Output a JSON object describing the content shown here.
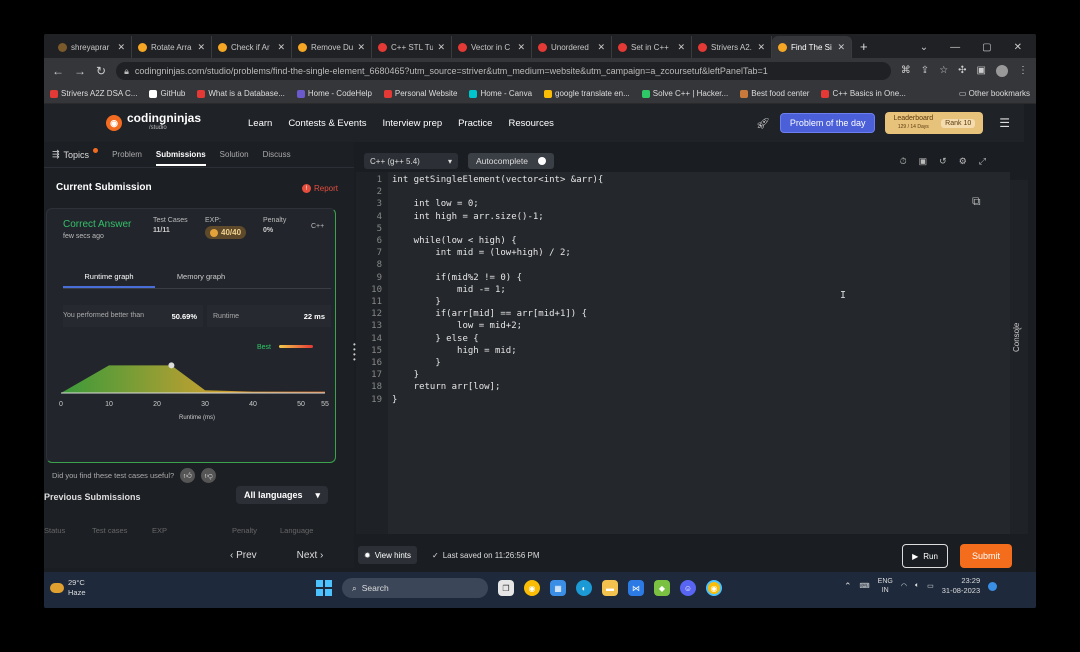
{
  "tabs": [
    {
      "label": "shreyaprar",
      "color": "#7a5a2a"
    },
    {
      "label": "Rotate Arra",
      "color": "#f5a623"
    },
    {
      "label": "Check if Ar",
      "color": "#f5a623"
    },
    {
      "label": "Remove Du",
      "color": "#f5a623"
    },
    {
      "label": "C++ STL Tu",
      "color": "#e53935"
    },
    {
      "label": "Vector in C",
      "color": "#e53935"
    },
    {
      "label": "Unordered",
      "color": "#e53935"
    },
    {
      "label": "Set in C++",
      "color": "#e53935"
    },
    {
      "label": "Strivers A2.",
      "color": "#e53935"
    },
    {
      "label": "Find The Si",
      "color": "#f5a623"
    }
  ],
  "url": "codingninjas.com/studio/problems/find-the-single-element_6680465?utm_source=striver&utm_medium=website&utm_campaign=a_zcoursetuf&leftPanelTab=1",
  "bookmarks": [
    {
      "label": "Strivers A2Z DSA C...",
      "color": "#e53935"
    },
    {
      "label": "GitHub",
      "color": "#ffffff"
    },
    {
      "label": "What is a Database...",
      "color": "#e53935"
    },
    {
      "label": "Home - CodeHelp",
      "color": "#6a5acd"
    },
    {
      "label": "Personal Website",
      "color": "#e53935"
    },
    {
      "label": "Home - Canva",
      "color": "#00c4cc"
    },
    {
      "label": "google translate en...",
      "color": "#fbbc05"
    },
    {
      "label": "Solve C++ | Hacker...",
      "color": "#2ec866"
    },
    {
      "label": "Best food center",
      "color": "#c97a3a"
    },
    {
      "label": "C++ Basics in One...",
      "color": "#e53935"
    }
  ],
  "bookmarks_other": "Other bookmarks",
  "site": {
    "logo": "codingninjas",
    "logo_sub": "/studio",
    "nav": [
      "Learn",
      "Contests & Events",
      "Interview prep",
      "Practice",
      "Resources"
    ],
    "potd": "Problem of the day",
    "leaderboard": "Leaderboard",
    "leaderboard_sub": "129 / 14 Days",
    "rank": "Rank 10"
  },
  "panel": {
    "topics": "Topics",
    "tabs": [
      "Problem",
      "Submissions",
      "Solution",
      "Discuss"
    ],
    "current_title": "Current Submission",
    "report": "Report",
    "status": "Correct Answer",
    "ago": "few secs ago",
    "test_cases_label": "Test Cases",
    "test_cases": "11/11",
    "exp_label": "EXP:",
    "exp": "40/40",
    "penalty_label": "Penalty",
    "penalty": "0%",
    "lang": "C++",
    "graph_tabs": [
      "Runtime graph",
      "Memory graph"
    ],
    "performed_label": "You performed better than",
    "performed": "50.69%",
    "runtime_label": "Runtime",
    "runtime": "22 ms",
    "best_label": "Best",
    "feedback": "Did you find these test cases useful?",
    "prev_title": "Previous Submissions",
    "lang_filter": "All languages",
    "cols": [
      "Status",
      "Test cases",
      "EXP",
      "Penalty",
      "Language"
    ]
  },
  "chart_data": {
    "type": "area",
    "x": [
      0,
      10,
      20,
      23,
      30,
      40,
      50,
      55
    ],
    "y": [
      0,
      1,
      1,
      1,
      0.1,
      0.05,
      0.05,
      0.05
    ],
    "xticks": [
      0,
      10,
      20,
      30,
      40,
      50,
      55
    ],
    "xlabel": "Runtime (ms)",
    "xlim": [
      0,
      55
    ],
    "highlight_x": 23,
    "legend": "Best"
  },
  "editor": {
    "language": "C++ (g++ 5.4)",
    "autocomplete": "Autocomplete",
    "lines": [
      "int getSingleElement(vector<int> &arr){",
      "",
      "    int low = 0;",
      "    int high = arr.size()-1;",
      "",
      "    while(low < high) {",
      "        int mid = (low+high) / 2;",
      "",
      "        if(mid%2 != 0) {",
      "            mid -= 1;",
      "        }",
      "        if(arr[mid] == arr[mid+1]) {",
      "            low = mid+2;",
      "        } else {",
      "            high = mid;",
      "        }",
      "    }",
      "    return arr[low];",
      "}"
    ],
    "console_label": "Console"
  },
  "bottom": {
    "prev": "‹ Prev",
    "next": "Next ›",
    "hints": "View hints",
    "saved": "Last saved on 11:26:56 PM",
    "run": "Run",
    "submit": "Submit"
  },
  "taskbar": {
    "temp": "29°C",
    "weather": "Haze",
    "search": "Search",
    "lang_top": "ENG",
    "lang_bottom": "IN",
    "time": "23:29",
    "date": "31-08-2023"
  }
}
